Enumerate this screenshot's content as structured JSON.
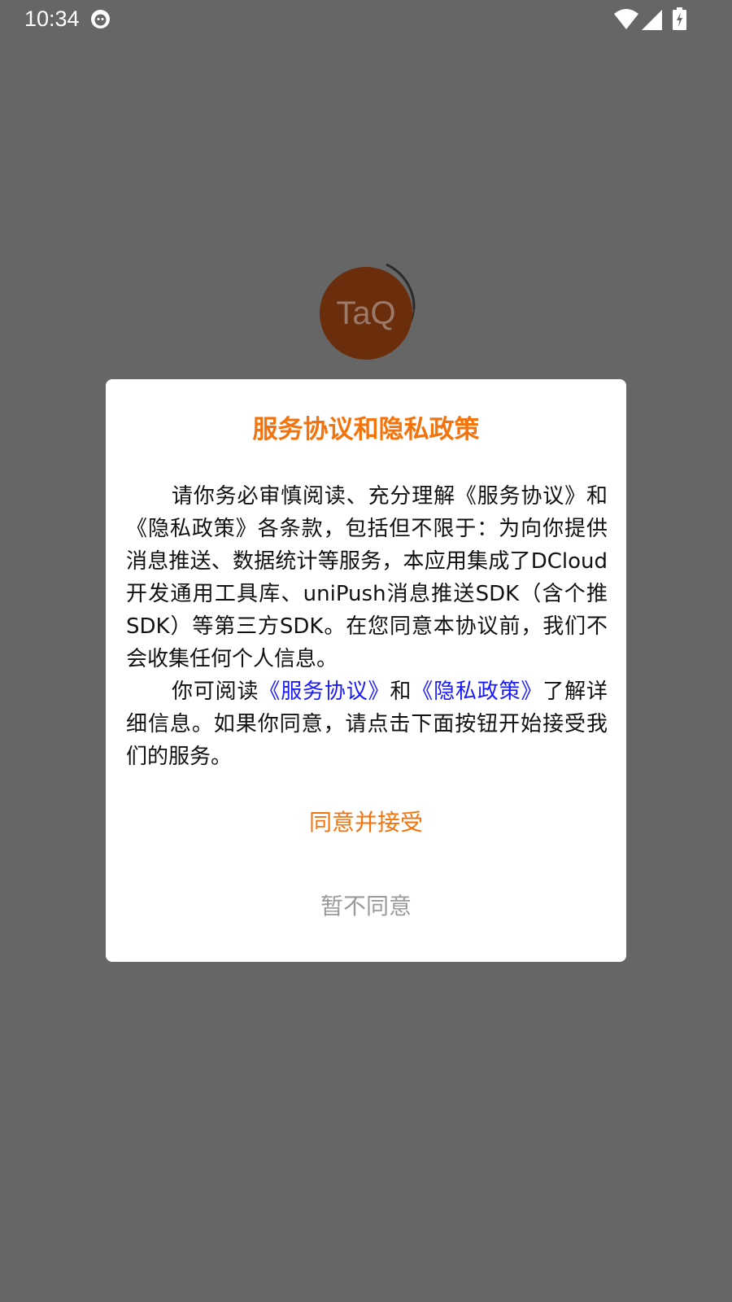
{
  "status_bar": {
    "time": "10:34",
    "icons": [
      "app-notification-icon",
      "wifi-icon",
      "signal-icon",
      "battery-charging-icon"
    ]
  },
  "logo": {
    "text": "TaQ",
    "bg_color": "#6b2e0d"
  },
  "dialog": {
    "title": "服务协议和隐私政策",
    "paragraph1": "请你务必审慎阅读、充分理解《服务协议》和《隐私政策》各条款，包括但不限于：为向你提供消息推送、数据统计等服务，本应用集成了DCloud开发通用工具库、uniPush消息推送SDK（含个推SDK）等第三方SDK。在您同意本协议前，我们不会收集任何个人信息。",
    "paragraph2_prefix": "你可阅读",
    "service_link": "《服务协议》",
    "paragraph2_and": "和",
    "privacy_link": "《隐私政策》",
    "paragraph2_suffix": "了解详细信息。如果你同意，请点击下面按钮开始接受我们的服务。",
    "agree_label": "同意并接受",
    "decline_label": "暂不同意"
  },
  "colors": {
    "accent": "#f3730d",
    "link": "#1a1aff",
    "overlay": "#666666",
    "decline": "#9a9a9a"
  }
}
